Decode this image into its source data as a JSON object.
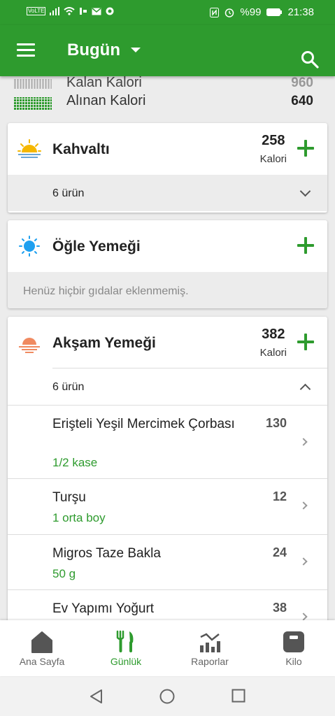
{
  "status_bar": {
    "time": "21:38",
    "battery": "%99",
    "volte": "VoLTE"
  },
  "app_bar": {
    "title": "Bugün",
    "menu_icon": "menu-icon",
    "search_icon": "search-icon"
  },
  "summary": {
    "remaining_label": "Kalan Kalori",
    "remaining_value": "960",
    "consumed_label": "Alınan Kalori",
    "consumed_value": "640"
  },
  "meals": {
    "breakfast": {
      "name": "Kahvaltı",
      "calories": "258",
      "unit": "Kalori",
      "items_count": "6 ürün",
      "icon": "sunrise-icon"
    },
    "lunch": {
      "name": "Öğle Yemeği",
      "empty_text": "Henüz hiçbir gıdalar eklenmemiş.",
      "icon": "sun-icon"
    },
    "dinner": {
      "name": "Akşam Yemeği",
      "calories": "382",
      "unit": "Kalori",
      "items_count": "6 ürün",
      "icon": "sunset-icon",
      "items": [
        {
          "name": "Erişteli Yeşil Mercimek Çorbası",
          "qty": "1/2 kase",
          "cal": "130"
        },
        {
          "name": "Turşu",
          "qty": "1  orta boy",
          "cal": "12"
        },
        {
          "name": "Migros Taze Bakla",
          "qty": "50  g",
          "cal": "24"
        },
        {
          "name": "Ev Yapımı Yoğurt",
          "qty": "",
          "cal": "38"
        }
      ]
    }
  },
  "bottom_nav": [
    {
      "label": "Ana Sayfa",
      "icon": "home-icon"
    },
    {
      "label": "Günlük",
      "icon": "fork-knife-icon",
      "active": true
    },
    {
      "label": "Raporlar",
      "icon": "chart-icon"
    },
    {
      "label": "Kilo",
      "icon": "scale-icon"
    }
  ],
  "colors": {
    "primary": "#2e9b2e",
    "background": "#ececec"
  }
}
